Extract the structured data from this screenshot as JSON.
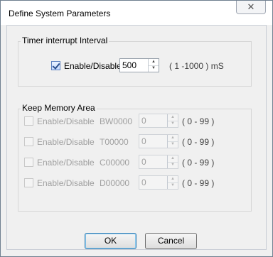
{
  "window": {
    "title": "Define System Parameters",
    "close_glyph": "✕"
  },
  "timer": {
    "group_label": "Timer interrupt Interval",
    "enable_label": "Enable/Disable",
    "value": "500",
    "range": "( 1 -1000 ) mS",
    "checked": true
  },
  "memory": {
    "group_label": "Keep Memory Area",
    "rows": [
      {
        "enable_label": "Enable/Disable",
        "name": "BW0000",
        "value": "0",
        "range": "( 0 - 99 )"
      },
      {
        "enable_label": "Enable/Disable",
        "name": "T00000",
        "value": "0",
        "range": "( 0 - 99 )"
      },
      {
        "enable_label": "Enable/Disable",
        "name": "C00000",
        "value": "0",
        "range": "( 0 - 99 )"
      },
      {
        "enable_label": "Enable/Disable",
        "name": "D00000",
        "value": "0",
        "range": "( 0 - 99 )"
      }
    ]
  },
  "buttons": {
    "ok": "OK",
    "cancel": "Cancel"
  },
  "icons": {
    "close": "close-icon",
    "up": "spin-up-arrow-icon",
    "down": "spin-down-arrow-icon",
    "check": "checkmark-icon"
  }
}
